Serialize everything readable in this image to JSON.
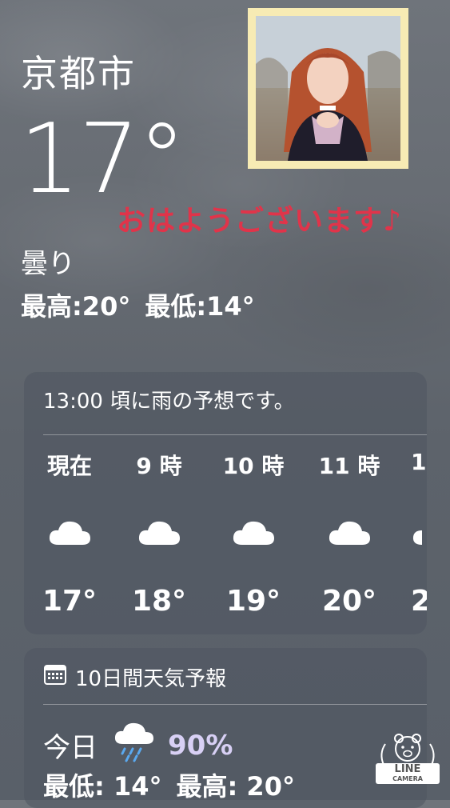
{
  "location": {
    "city": "京都市"
  },
  "current": {
    "temperature": "17°",
    "condition": "曇り",
    "high": "最高:20°",
    "low": "最低:14°"
  },
  "overlay": {
    "greeting": "おはようございます♪"
  },
  "hourly": {
    "note": "13:00 頃に雨の予想です。",
    "items": [
      {
        "label": "現在",
        "icon": "cloud-icon",
        "temp": "17°"
      },
      {
        "label": "9 時",
        "icon": "cloud-icon",
        "temp": "18°"
      },
      {
        "label": "10 時",
        "icon": "cloud-icon",
        "temp": "19°"
      },
      {
        "label": "11 時",
        "icon": "cloud-icon",
        "temp": "20°"
      },
      {
        "label": "1",
        "icon": "cloud-icon",
        "temp": "2"
      }
    ]
  },
  "daily": {
    "header": "10日間天気予報",
    "today": {
      "day": "今日",
      "icon": "rain-cloud-icon",
      "precip": "90%",
      "low": "最低: 14°",
      "high": "最高: 20°"
    }
  },
  "watermark": {
    "line1": "LINE",
    "line2": "CAMERA"
  },
  "colors": {
    "greeting": "#e0344a",
    "precip": "#d8d0f5",
    "frame": "#f7ebb4",
    "card": "#4e5660"
  }
}
